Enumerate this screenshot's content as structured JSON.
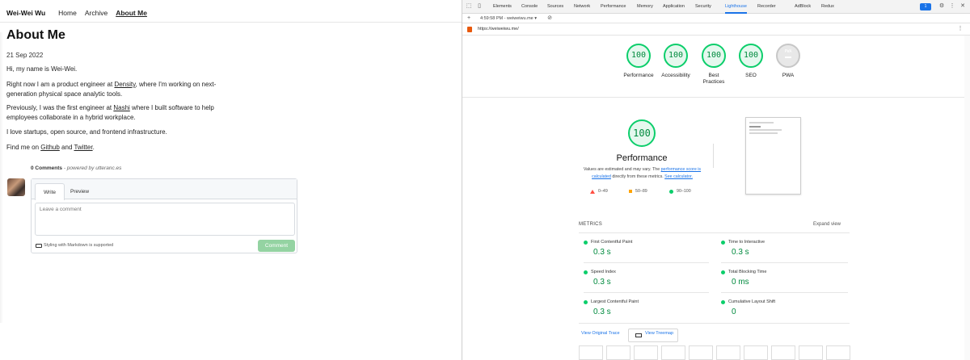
{
  "site": {
    "name": "Wei-Wei Wu",
    "nav": [
      "Home",
      "Archive",
      "About Me"
    ],
    "page_title": "About Me",
    "date": "21 Sep 2022",
    "intro": "Hi, my name is Wei-Wei.",
    "p1_before": "Right now I am a product engineer at ",
    "p1_link": "Density",
    "p1_after": ", where I'm working on next-generation physical space analytic tools.",
    "p2_before": "Previously, I was the first engineer at ",
    "p2_link": "Nashi",
    "p2_after": " where I built software to help employees collaborate in a hybrid workplace.",
    "p3": "I love startups, open source, and frontend infrastructure.",
    "p4_before": "Find me on ",
    "p4_link1": "Github",
    "p4_mid": " and ",
    "p4_link2": "Twitter",
    "p4_after": "."
  },
  "comments": {
    "count": "0 Comments",
    "powered": "- powered by utteranc.es",
    "tab_write": "Write",
    "tab_preview": "Preview",
    "placeholder": "Leave a comment",
    "markdown_note": "Styling with Markdown is supported",
    "submit": "Comment"
  },
  "devtools": {
    "tabs": [
      "Elements",
      "Console",
      "Sources",
      "Network",
      "Performance",
      "Memory",
      "Application",
      "Security",
      "Lighthouse",
      "Recorder",
      "AdBlock",
      "Redux"
    ],
    "active_tab": "Lighthouse",
    "issues_count": "1",
    "report_time": "4:59:58 PM - weiweiwu.me",
    "url": "https://weiweiwu.me/"
  },
  "lighthouse": {
    "categories": [
      {
        "label": "Performance",
        "score": "100"
      },
      {
        "label": "Accessibility",
        "score": "100"
      },
      {
        "label": "Best Practices",
        "score": "100"
      },
      {
        "label": "SEO",
        "score": "100"
      }
    ],
    "pwa_label": "PWA",
    "pwa_badge": "PWA",
    "performance": {
      "score": "100",
      "title": "Performance",
      "desc_1": "Values are estimated and may vary. The ",
      "desc_link1": "performance score is calculated",
      "desc_2": " directly from these metrics. ",
      "desc_link2": "See calculator."
    },
    "legend": [
      {
        "range": "0–49",
        "color": "#ff4e42"
      },
      {
        "range": "50–89",
        "color": "#ffa400"
      },
      {
        "range": "90–100",
        "color": "#0cce6b"
      }
    ],
    "metrics_title": "METRICS",
    "expand_view": "Expand view",
    "metrics": [
      {
        "name": "First Contentful Paint",
        "value": "0.3 s"
      },
      {
        "name": "Time to Interactive",
        "value": "0.3 s"
      },
      {
        "name": "Speed Index",
        "value": "0.3 s"
      },
      {
        "name": "Total Blocking Time",
        "value": "0 ms"
      },
      {
        "name": "Largest Contentful Paint",
        "value": "0.3 s"
      },
      {
        "name": "Cumulative Layout Shift",
        "value": "0"
      }
    ],
    "view_trace": "View Original Trace",
    "view_treemap": "View Treemap"
  },
  "colors": {
    "pass_green": "#0cce6b",
    "pass_text": "#008a3e",
    "link_blue": "#1a73e8"
  }
}
